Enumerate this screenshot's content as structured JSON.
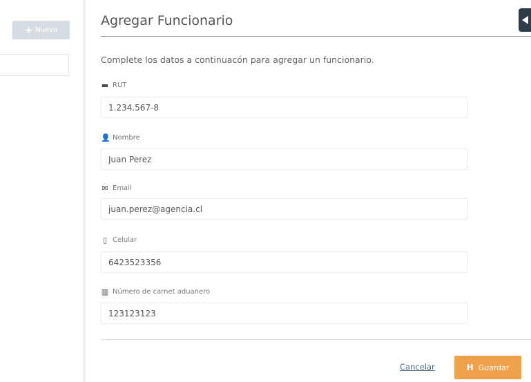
{
  "sidebar": {
    "new_button_icon": "+",
    "new_button_label": "Nuevo"
  },
  "modal": {
    "title": "Agregar Funcionario",
    "intro": "Complete los datos a continuacón para agregar un funcionario.",
    "fields": [
      {
        "icon": "id-card-icon",
        "icon_glyph": "▬",
        "label": "RUT",
        "value": "1.234.567-8"
      },
      {
        "icon": "user-icon",
        "icon_glyph": "👤",
        "label": "Nombre",
        "value": "Juan Perez"
      },
      {
        "icon": "envelope-icon",
        "icon_glyph": "✉",
        "label": "Email",
        "value": "juan.perez@agencia.cl"
      },
      {
        "icon": "phone-icon",
        "icon_glyph": "▯",
        "label": "Celular",
        "value": "6423523356"
      },
      {
        "icon": "barcode-icon",
        "icon_glyph": "▥",
        "label": "Número de carnet aduanero",
        "value": "123123123"
      }
    ],
    "cancel_label": "Cancelar",
    "save_icon": "H",
    "save_label": "Guardar"
  },
  "colors": {
    "accent": "#f0a14a",
    "dark_tab": "#2f3d4a",
    "link": "#4d6e8a"
  }
}
